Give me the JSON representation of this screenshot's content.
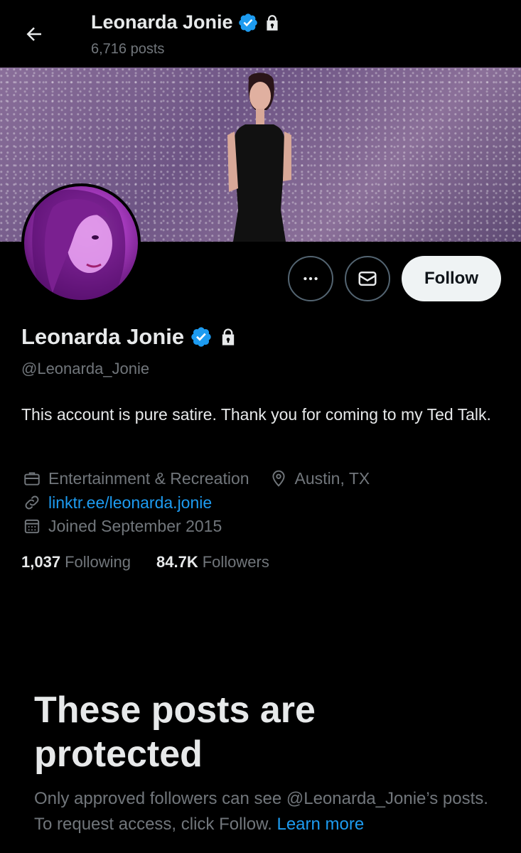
{
  "header": {
    "name": "Leonarda Jonie",
    "posts_count": "6,716 posts"
  },
  "profile": {
    "name": "Leonarda Jonie",
    "handle": "@Leonarda_Jonie",
    "bio": "This account is pure satire. Thank you for coming to my Ted Talk.",
    "category": "Entertainment & Recreation",
    "location": "Austin, TX",
    "link": "linktr.ee/leonarda.jonie",
    "joined": "Joined September 2015",
    "following_count": "1,037",
    "following_label": "Following",
    "followers_count": "84.7K",
    "followers_label": "Followers"
  },
  "actions": {
    "follow_label": "Follow"
  },
  "protected": {
    "title": "These posts are protected",
    "desc_prefix": "Only approved followers can see @Leonarda_Jonie’s posts. To request access, click Follow.",
    "learn_more": "Learn more"
  },
  "icons": {
    "back": "arrow-left-icon",
    "verified": "verified-badge-icon",
    "lock": "lock-icon",
    "more": "more-icon",
    "message": "mail-icon",
    "category": "briefcase-icon",
    "location": "location-pin-icon",
    "link": "link-icon",
    "calendar": "calendar-icon"
  },
  "colors": {
    "accent": "#1d9bf0",
    "background": "#000000",
    "text_primary": "#e7e9ea",
    "text_secondary": "#71767b"
  }
}
